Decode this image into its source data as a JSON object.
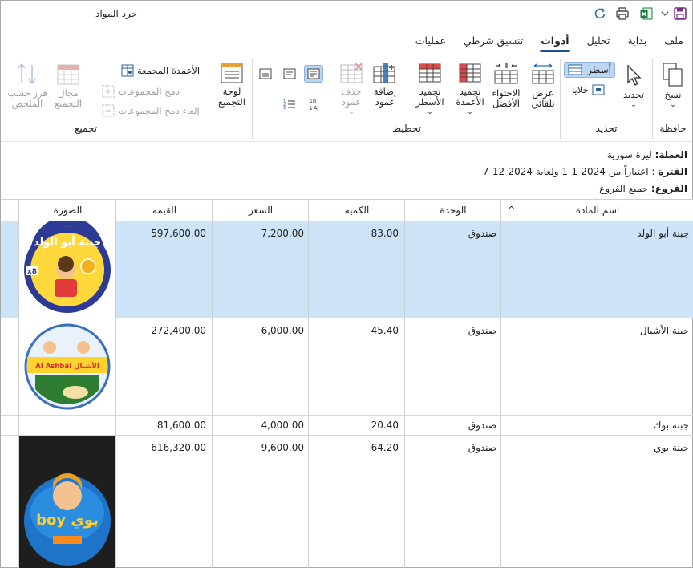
{
  "window": {
    "title": "جرد المواد"
  },
  "menu": {
    "tabs": [
      {
        "label": "ملف",
        "active": false
      },
      {
        "label": "بداية",
        "active": false
      },
      {
        "label": "تحليل",
        "active": false
      },
      {
        "label": "أدوات",
        "active": true
      },
      {
        "label": "تنسيق شرطي",
        "active": false
      },
      {
        "label": "عمليات",
        "active": false
      }
    ]
  },
  "ribbon": {
    "clipboard": {
      "copy": "نسخ",
      "group": "حافظة"
    },
    "selection": {
      "select": "تحديد",
      "rows": "أسطر",
      "cells": "خلايا",
      "group": "تحديد"
    },
    "layout": {
      "auto_view": "عرض تلقائي",
      "best_fit": "الاحتواء الأفضل",
      "freeze_columns": "تجميد الأعمدة",
      "freeze_rows": "تجميد الأسطر",
      "add_column": "إضافة عمود",
      "delete_column": "حذف عمود",
      "group": "تخطيط"
    },
    "grouping": {
      "panel": "لوحة التجميع",
      "grouped_columns": "الأعمدة المجمعة",
      "merge_groups": "دمج المجموعات",
      "unmerge_groups": "إلغاء دمج المجموعات",
      "group_range": "مجال التجميع",
      "sort_by_summary": "فرز حسب الملخص",
      "group": "تجميع"
    }
  },
  "report": {
    "currency_label": "العملة:",
    "currency_value": "ليرة سورية",
    "period_label": "الفترة",
    "period_value": ": اعتباراً من 2024-1-1 ولغاية 2024-12-7",
    "branches_label": "الفروع:",
    "branches_value": "جميع الفروع"
  },
  "table": {
    "headers": {
      "name": "اسم المادة",
      "unit": "الوحدة",
      "qty": "الكمية",
      "price": "السعر",
      "value": "القيمة",
      "image": "الصورة"
    },
    "rows": [
      {
        "name": "جبنة أبو الولد",
        "unit": "صندوق",
        "qty": "83.00",
        "price": "7,200.00",
        "value": "597,600.00",
        "image": "abu-alwalad-cheese",
        "img_text": "جبنة أبو الولد",
        "img_badge": "x8"
      },
      {
        "name": "جبنة الأشبال",
        "unit": "صندوق",
        "qty": "45.40",
        "price": "6,000.00",
        "value": "272,400.00",
        "image": "al-ashbal-cheese",
        "img_text": "Al Ashbal الأشبال"
      },
      {
        "name": "جبنة بوك",
        "unit": "صندوق",
        "qty": "20.40",
        "price": "4,000.00",
        "value": "81,600.00",
        "image": ""
      },
      {
        "name": "جبنة بوي",
        "unit": "صندوق",
        "qty": "64.20",
        "price": "9,600.00",
        "value": "616,320.00",
        "image": "boy-cheese",
        "img_text": "boy بوي"
      }
    ]
  },
  "colors": {
    "selection": "#cde3f8",
    "accent": "#1f4e9c"
  }
}
